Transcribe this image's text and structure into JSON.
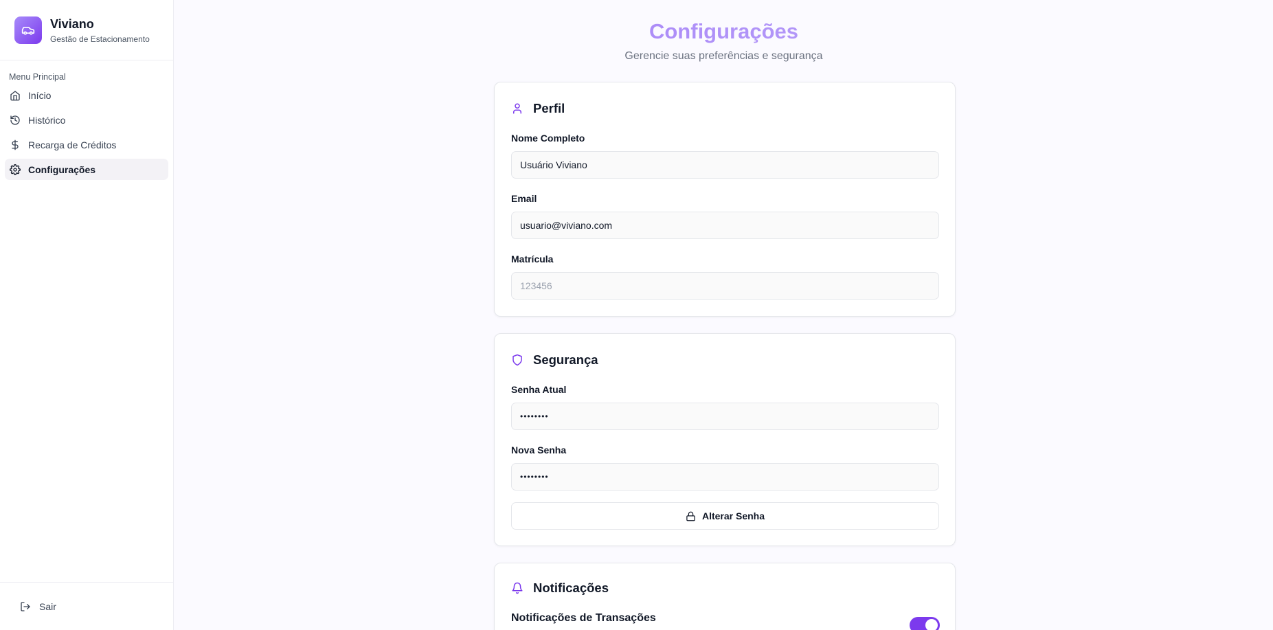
{
  "brand": {
    "name": "Viviano",
    "subtitle": "Gestão de Estacionamento",
    "logo_icon": "car-icon",
    "accent": "#7c3aed"
  },
  "sidebar": {
    "menu_label": "Menu Principal",
    "items": [
      {
        "label": "Início",
        "icon": "home-icon",
        "active": false
      },
      {
        "label": "Histórico",
        "icon": "history-icon",
        "active": false
      },
      {
        "label": "Recarga de Créditos",
        "icon": "dollar-icon",
        "active": false
      },
      {
        "label": "Configurações",
        "icon": "gear-icon",
        "active": true
      }
    ],
    "logout_label": "Sair"
  },
  "header": {
    "title": "Configurações",
    "subtitle": "Gerencie suas preferências e segurança"
  },
  "profile": {
    "title": "Perfil",
    "name_label": "Nome Completo",
    "name_value": "Usuário Viviano",
    "email_label": "Email",
    "email_value": "usuario@viviano.com",
    "matricula_label": "Matrícula",
    "matricula_placeholder": "123456"
  },
  "security": {
    "title": "Segurança",
    "current_label": "Senha Atual",
    "current_value": "••••••••",
    "new_label": "Nova Senha",
    "new_value": "••••••••",
    "change_button": "Alterar Senha"
  },
  "notifications": {
    "title": "Notificações",
    "transactions_label": "Notificações de Transações",
    "transactions_enabled": true
  }
}
